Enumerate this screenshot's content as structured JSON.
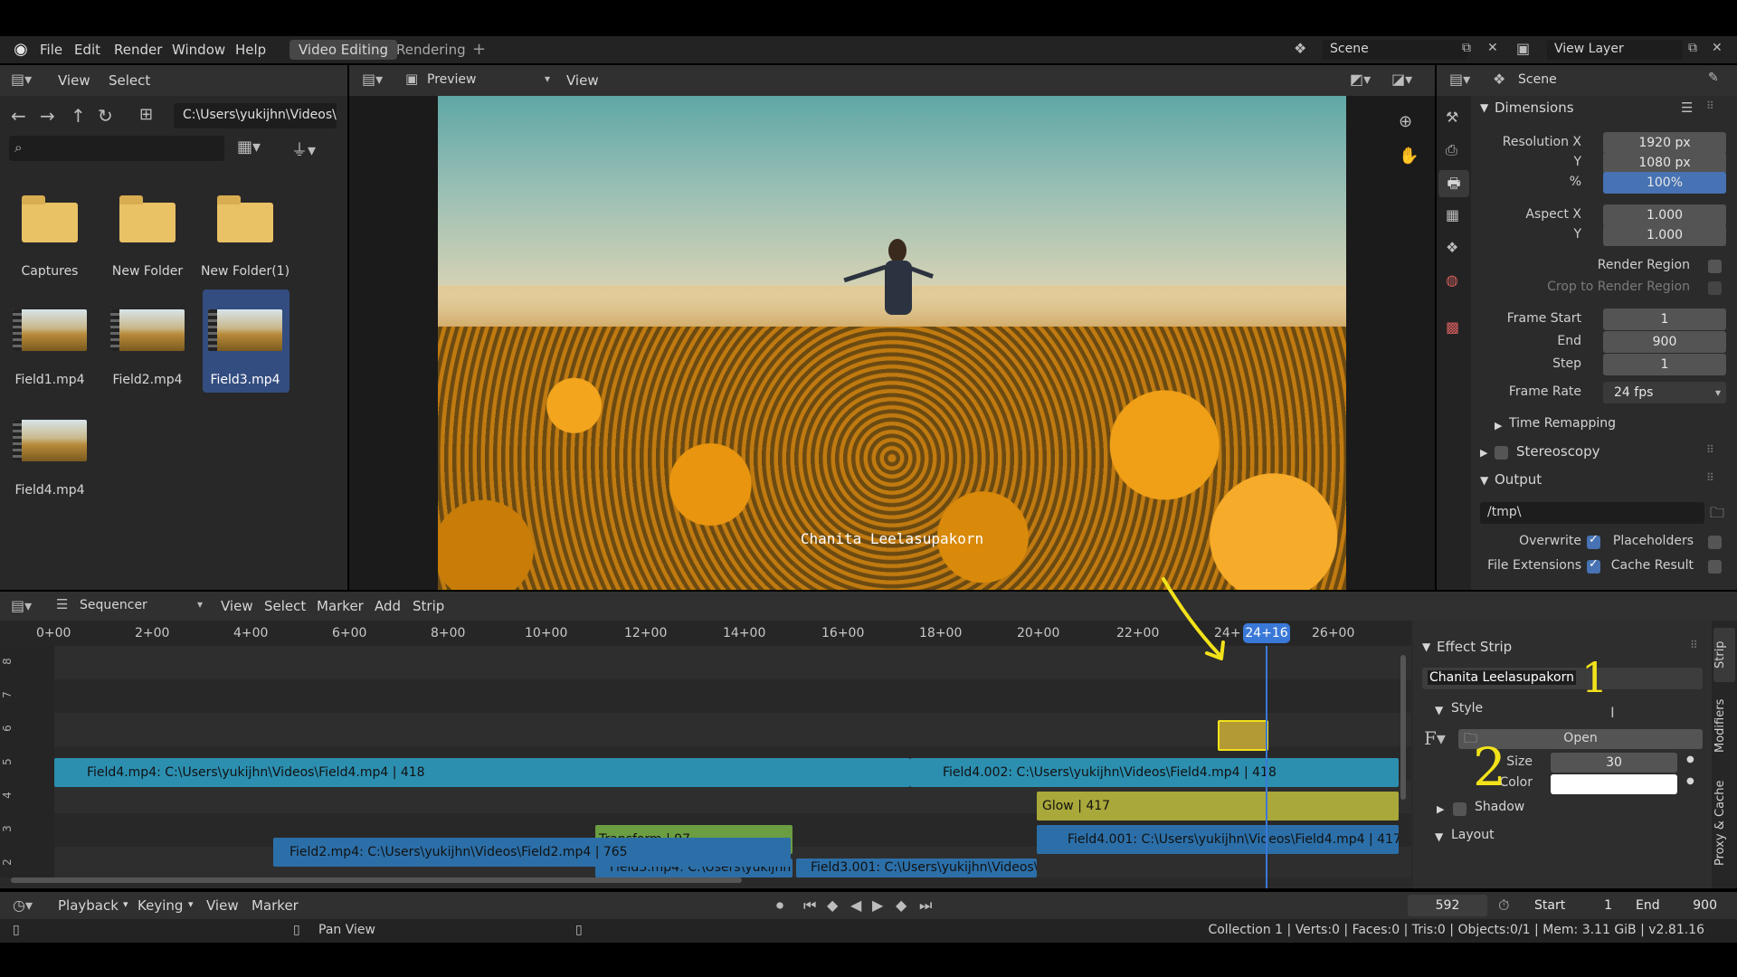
{
  "topbar": {
    "menus": [
      "File",
      "Edit",
      "Render",
      "Window",
      "Help"
    ],
    "workspace_tabs": [
      "Video Editing",
      "Rendering"
    ],
    "scene_label": "Scene",
    "view_layer_label": "View Layer"
  },
  "file_browser": {
    "header_menus": [
      "View",
      "Select"
    ],
    "path": "C:\\Users\\yukijhn\\Videos\\",
    "folders": [
      "Captures",
      "New Folder",
      "New Folder(1)"
    ],
    "files": [
      "Field1.mp4",
      "Field2.mp4",
      "Field3.mp4",
      "Field4.mp4"
    ],
    "selected_file": "Field3.mp4"
  },
  "preview": {
    "mode": "Preview",
    "view_menu": "View",
    "caption": "Chanita Leelasupakorn"
  },
  "properties": {
    "context": "Scene",
    "dimensions_title": "Dimensions",
    "resolution_x_label": "Resolution X",
    "resolution_x": "1920 px",
    "resolution_y_label": "Y",
    "resolution_y": "1080 px",
    "percent_label": "%",
    "percent": "100%",
    "percent_fraction": 1.0,
    "aspect_x_label": "Aspect X",
    "aspect_x": "1.000",
    "aspect_y_label": "Y",
    "aspect_y": "1.000",
    "render_region": "Render Region",
    "crop_region": "Crop to Render Region",
    "frame_start_label": "Frame Start",
    "frame_start": "1",
    "end_label": "End",
    "end": "900",
    "step_label": "Step",
    "step": "1",
    "frame_rate_label": "Frame Rate",
    "frame_rate": "24 fps",
    "time_remapping": "Time Remapping",
    "stereoscopy": "Stereoscopy",
    "output_title": "Output",
    "output_path": "/tmp\\",
    "overwrite": "Overwrite",
    "placeholders": "Placeholders",
    "file_extensions": "File Extensions",
    "cache_result": "Cache Result"
  },
  "sequencer": {
    "editor": "Sequencer",
    "menus": [
      "View",
      "Select",
      "Marker",
      "Add",
      "Strip"
    ],
    "time_ticks": [
      "0+00",
      "2+00",
      "4+00",
      "6+00",
      "8+00",
      "10+00",
      "12+00",
      "14+00",
      "16+00",
      "18+00",
      "20+00",
      "22+00",
      "24+",
      "26+00"
    ],
    "current_time": "24+16",
    "channels": [
      "8",
      "7",
      "6",
      "5",
      "4",
      "3",
      "2"
    ],
    "strips": {
      "field4": "Field4.mp4: C:\\Users\\yukijhn\\Videos\\Field4.mp4 | 418",
      "field4_002": "Field4.002: C:\\Users\\yukijhn\\Videos\\Field4.mp4 | 418",
      "glow": "Glow | 417",
      "transform": "Transform | 97",
      "field4_001": "Field4.001: C:\\Users\\yukijhn\\Videos\\Field4.mp4 | 417",
      "field3": "Field3.mp4: C:\\Users\\yukijhn",
      "field3_001": "Field3.001: C:\\Users\\yukijhn\\Videos\\",
      "field2": "Field2.mp4: C:\\Users\\yukijhn\\Videos\\Field2.mp4 | 765"
    }
  },
  "effect_panel": {
    "title": "Effect Strip",
    "text_value": "Chanita Leelasupakorn",
    "style_title": "Style",
    "open_button": "Open",
    "size_label": "Size",
    "size": "30",
    "color_label": "Color",
    "color_value": "#ffffff",
    "shadow_label": "Shadow",
    "layout_title": "Layout",
    "tabs": [
      "Strip",
      "Modifiers",
      "Proxy & Cache"
    ],
    "annotations": [
      "1",
      "2"
    ]
  },
  "timeline_footer": {
    "menus": [
      "Playback",
      "Keying",
      "View",
      "Marker"
    ],
    "current_frame": "592",
    "start_label": "Start",
    "start": "1",
    "end_label": "End",
    "end": "900"
  },
  "statusbar": {
    "hint": "Pan View",
    "stats": "Collection 1 | Verts:0 | Faces:0 | Tris:0 | Objects:0/1 | Mem: 3.11 GiB | v2.81.16"
  },
  "colors": {
    "accent_blue": "#4772b3",
    "playhead": "#3a78d8",
    "movie_strip": "#2c8fb0",
    "effect_strip": "#a9a83a",
    "transform_strip": "#6b9d43",
    "annotation_yellow": "#f2e21a"
  }
}
